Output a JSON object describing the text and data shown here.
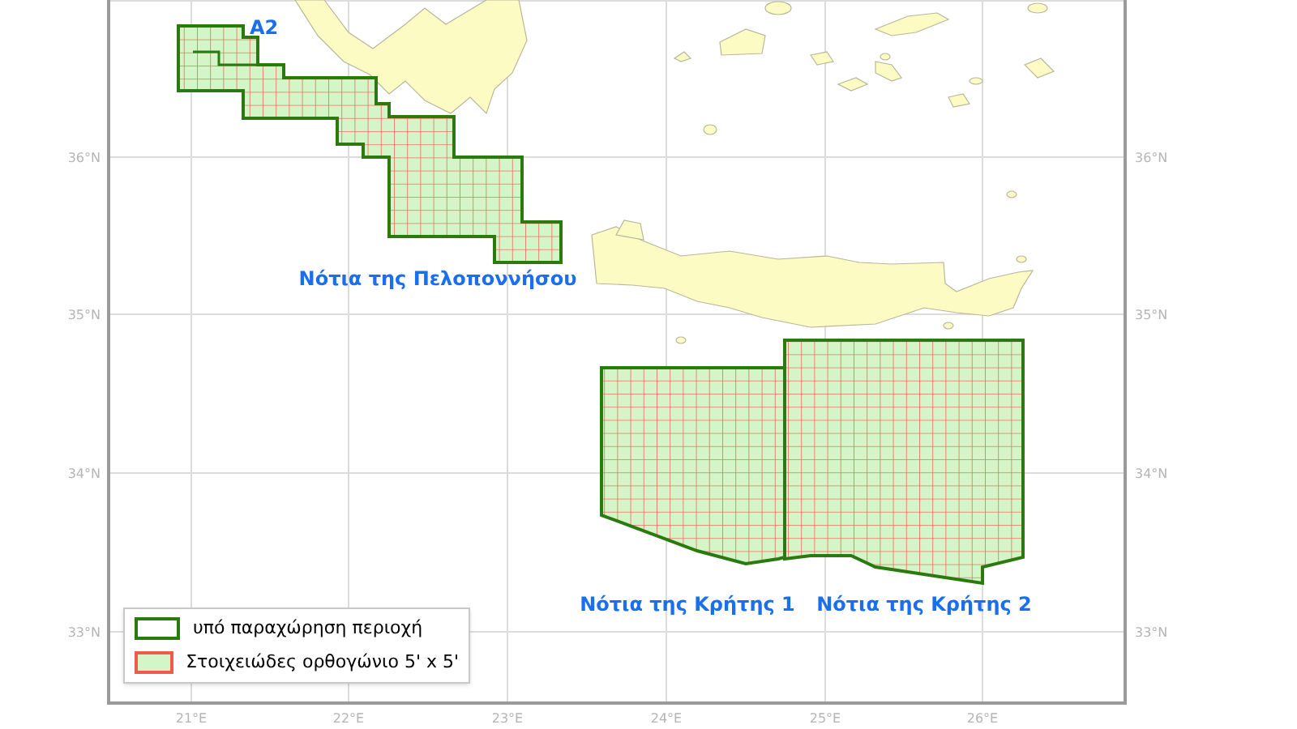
{
  "map": {
    "lat_labels_left": [
      "36°N",
      "35°N",
      "34°N",
      "33°N"
    ],
    "lat_labels_right": [
      "36°N",
      "35°N",
      "34°N",
      "33°N"
    ],
    "lon_labels": [
      "21°E",
      "22°E",
      "23°E",
      "24°E",
      "25°E",
      "26°E"
    ],
    "area_labels": [
      "A2",
      "Νότια της Πελοποννήσου",
      "Νότια της Κρήτης 1",
      "Νότια της Κρήτης 2"
    ]
  },
  "legend": [
    {
      "kind": "concession",
      "label": "υπό παραχώρηση περιοχή"
    },
    {
      "kind": "block",
      "label": "Στοιχειώδες ορθογώνιο 5' x 5'"
    }
  ]
}
